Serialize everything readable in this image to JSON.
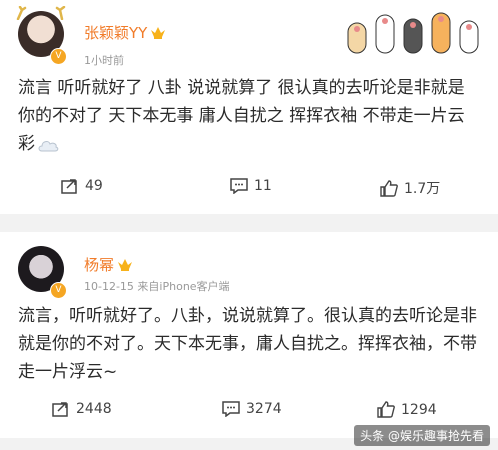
{
  "posts": [
    {
      "user": "张颖颖YY",
      "time": "1小时前",
      "content": "流言 听听就好了 八卦 说说就算了 很认真的去听论是非就是你的不对了 天下本无事 庸人自扰之 挥挥衣袖 不带走一片云彩",
      "reposts": "49",
      "comments": "11",
      "likes": "1.7万"
    },
    {
      "user": "杨幂",
      "time": "10-12-15  来自iPhone客户端",
      "content": "流言，听听就好了。八卦，说说就算了。很认真的去听论是非就是你的不对了。天下本无事，庸人自扰之。挥挥衣袖，不带走一片浮云~",
      "reposts": "2448",
      "comments": "3274",
      "likes": "1294"
    }
  ],
  "watermark": "头条 @娱乐趣事抢先看",
  "icons": {
    "verified": "v-badge-icon",
    "crown": "crown-icon",
    "repost": "repost-icon",
    "comment": "comment-icon",
    "like": "thumb-up-icon"
  },
  "colors": {
    "username": "#f17c2a",
    "badge": "#f5a623"
  }
}
